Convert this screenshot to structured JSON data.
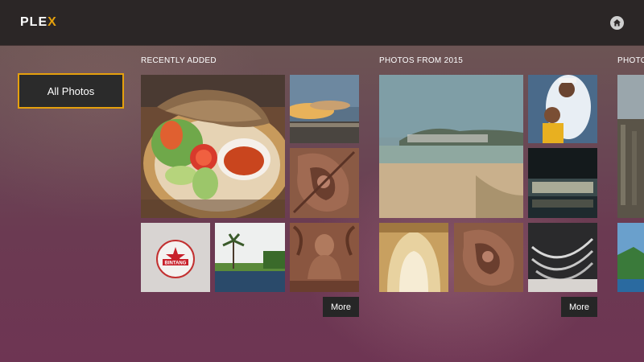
{
  "app": {
    "logo_text": "PLEX",
    "logo_accent_letter": "X"
  },
  "header": {
    "home_icon": "home-icon"
  },
  "sidebar": {
    "all_photos_label": "All Photos"
  },
  "sections": [
    {
      "title": "RECENTLY ADDED",
      "more_label": "More"
    },
    {
      "title": "PHOTOS FROM 2015",
      "more_label": "More"
    },
    {
      "title": "PHOTO"
    }
  ],
  "colors": {
    "accent": "#e5a00d",
    "topbar": "#2b2626",
    "button_bg": "#262626"
  }
}
